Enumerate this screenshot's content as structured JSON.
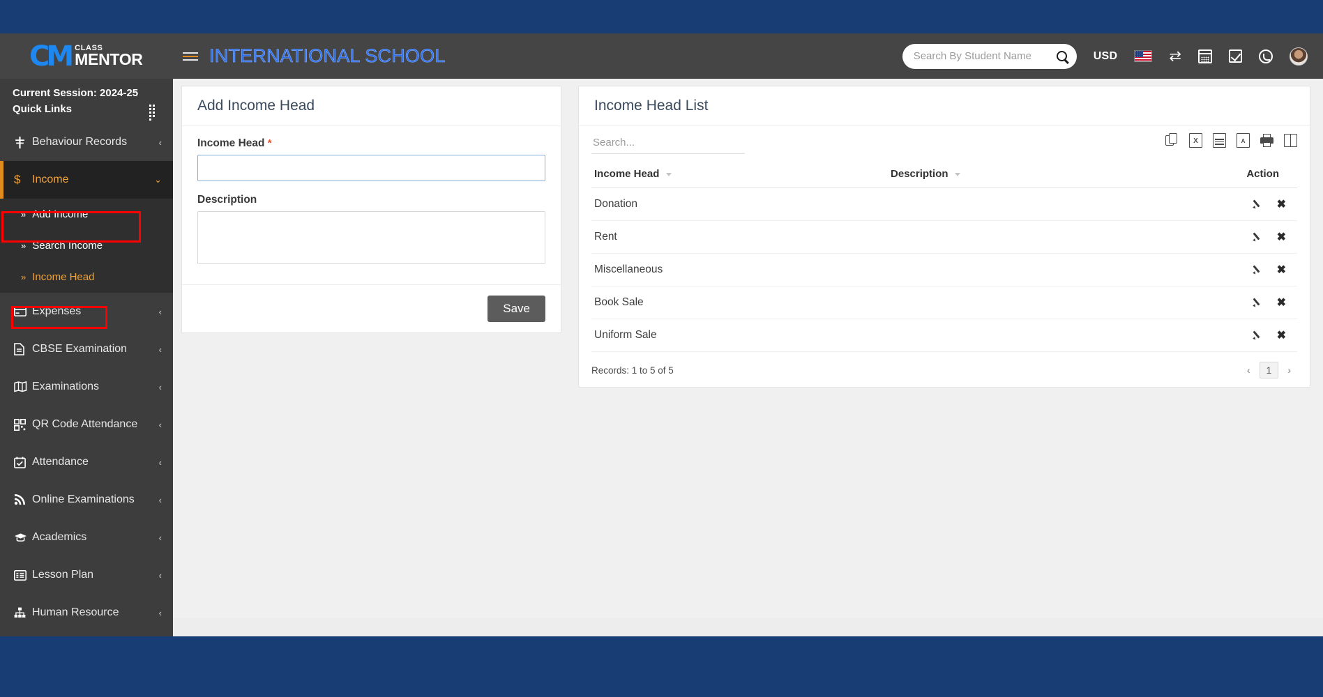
{
  "brand": {
    "logo_mark": "CM",
    "logo_line1": "CLASS",
    "logo_line2": "MENTOR"
  },
  "sidebar": {
    "session": "Current Session: 2024-25",
    "quick_links": "Quick Links",
    "quick_links_icon": "grid-icon",
    "items": [
      {
        "label": "Behaviour Records",
        "icon": "behaviour-icon",
        "glyph": "≡"
      },
      {
        "label": "Income",
        "icon": "dollar-icon",
        "glyph": "$",
        "active": true,
        "expanded": true
      },
      {
        "label": "Expenses",
        "icon": "credit-card-icon",
        "glyph": "▭"
      },
      {
        "label": "CBSE Examination",
        "icon": "document-icon",
        "glyph": "☷"
      },
      {
        "label": "Examinations",
        "icon": "book-icon",
        "glyph": "▤"
      },
      {
        "label": "QR Code Attendance",
        "icon": "qr-code-icon",
        "glyph": "▒"
      },
      {
        "label": "Attendance",
        "icon": "calendar-check-icon",
        "glyph": "☑"
      },
      {
        "label": "Online Examinations",
        "icon": "rss-icon",
        "glyph": "◤"
      },
      {
        "label": "Academics",
        "icon": "graduation-cap-icon",
        "glyph": "▲"
      },
      {
        "label": "Lesson Plan",
        "icon": "list-icon",
        "glyph": "☰"
      },
      {
        "label": "Human Resource",
        "icon": "sitemap-icon",
        "glyph": "⑂"
      }
    ],
    "submenu": [
      {
        "label": "Add Income",
        "active": false
      },
      {
        "label": "Search Income",
        "active": false
      },
      {
        "label": "Income Head",
        "active": true
      }
    ],
    "collapse_chevron": "‹",
    "expand_chevron": "⌄"
  },
  "topbar": {
    "menu_toggle_icon": "hamburger-icon",
    "school_title": "INTERNATIONAL SCHOOL",
    "search_placeholder": "Search By Student Name",
    "search_value": "",
    "search_icon": "search-icon",
    "currency": "USD",
    "flag_icon": "us-flag-icon",
    "exchange_icon": "exchange-icon",
    "exchange_glyph": "⇄",
    "calendar_icon": "calendar-icon",
    "task_icon": "checkbox-icon",
    "whatsapp_icon": "whatsapp-icon",
    "avatar_icon": "user-avatar"
  },
  "form_panel": {
    "title": "Add Income Head",
    "income_head_label": "Income Head",
    "required_mark": "*",
    "income_head_value": "",
    "description_label": "Description",
    "description_value": "",
    "save_label": "Save"
  },
  "list_panel": {
    "title": "Income Head List",
    "search_placeholder": "Search...",
    "search_value": "",
    "export_icons": [
      {
        "name": "copy-icon",
        "label": "Copy"
      },
      {
        "name": "excel-icon",
        "label": "X"
      },
      {
        "name": "csv-icon",
        "label": "CSV"
      },
      {
        "name": "pdf-icon",
        "label": "PDF"
      },
      {
        "name": "print-icon",
        "label": "Print"
      },
      {
        "name": "column-visibility-icon",
        "label": "Columns"
      }
    ],
    "columns": [
      "Income Head",
      "Description",
      "Action"
    ],
    "rows": [
      {
        "income_head": "Donation",
        "description": ""
      },
      {
        "income_head": "Rent",
        "description": ""
      },
      {
        "income_head": "Miscellaneous",
        "description": ""
      },
      {
        "income_head": "Book Sale",
        "description": ""
      },
      {
        "income_head": "Uniform Sale",
        "description": ""
      }
    ],
    "records_text": "Records: 1 to 5 of 5",
    "pagination": {
      "prev": "‹",
      "current": "1",
      "next": "›"
    },
    "edit_icon": "pencil-icon",
    "delete_icon": "close-icon",
    "delete_glyph": "✖"
  },
  "colors": {
    "outer_frame": "#183c74",
    "sidebar_bg": "#3d3d3d",
    "topbar_bg": "#454545",
    "accent_orange": "#f0a33a",
    "title_blue": "#2b6ef0",
    "annotation_red": "#ff0000",
    "logo_blue": "#1e88f0"
  }
}
